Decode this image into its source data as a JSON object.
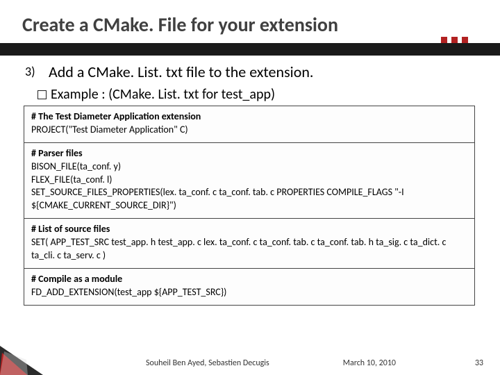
{
  "title": "Create a CMake. File  for your extension",
  "step_number": "3)",
  "step_text": "Add a CMake. List. txt file to the extension.",
  "example_label": "Example : (CMake. List. txt for test_app)",
  "code_blocks": [
    {
      "comment": "# The Test Diameter Application extension",
      "body": "PROJECT(\"Test Diameter Application\" C)"
    },
    {
      "comment": "# Parser files",
      "body": "BISON_FILE(ta_conf. y)\nFLEX_FILE(ta_conf. l)\nSET_SOURCE_FILES_PROPERTIES(lex. ta_conf. c ta_conf. tab. c PROPERTIES COMPILE_FLAGS \"-I ${CMAKE_CURRENT_SOURCE_DIR}\")"
    },
    {
      "comment": "# List of source files",
      "body": "SET( APP_TEST_SRC test_app. h test_app. c lex. ta_conf. c ta_conf. tab. c ta_conf. tab. h ta_sig. c ta_dict. c ta_cli. c ta_serv. c )"
    },
    {
      "comment": "# Compile as a module",
      "body": "FD_ADD_EXTENSION(test_app ${APP_TEST_SRC})"
    }
  ],
  "footer": {
    "authors": "Souheil Ben Ayed, Sebastien Decugis",
    "date": "March 10, 2010",
    "page": "33"
  }
}
